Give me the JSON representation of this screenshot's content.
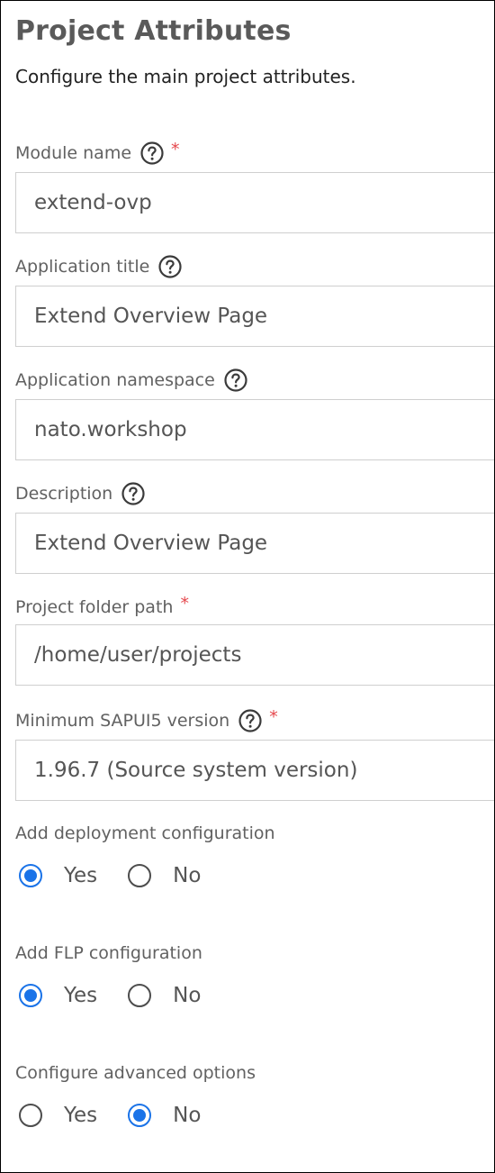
{
  "header": {
    "title": "Project Attributes",
    "subtitle": "Configure the main project attributes."
  },
  "fields": {
    "module_name": {
      "label": "Module name",
      "value": "extend-ovp",
      "required": "*"
    },
    "application_title": {
      "label": "Application title",
      "value": "Extend Overview Page"
    },
    "application_namespace": {
      "label": "Application namespace",
      "value": "nato.workshop"
    },
    "description": {
      "label": "Description",
      "value": "Extend Overview Page"
    },
    "project_folder_path": {
      "label": "Project folder path",
      "value": "/home/user/projects",
      "required": "*"
    },
    "min_sapui5_version": {
      "label": "Minimum SAPUI5 version",
      "value": "1.96.7 (Source system version)",
      "required": "*"
    }
  },
  "radios": {
    "deployment": {
      "label": "Add deployment configuration",
      "yes": "Yes",
      "no": "No",
      "selected": "Yes"
    },
    "flp": {
      "label": "Add FLP configuration",
      "yes": "Yes",
      "no": "No",
      "selected": "Yes"
    },
    "advanced": {
      "label": "Configure advanced options",
      "yes": "Yes",
      "no": "No",
      "selected": "No"
    }
  },
  "colors": {
    "accent": "#1a73e8",
    "required": "#e5484d",
    "border": "#cfcfcf"
  },
  "icons": {
    "help": "question-mark-circle"
  }
}
